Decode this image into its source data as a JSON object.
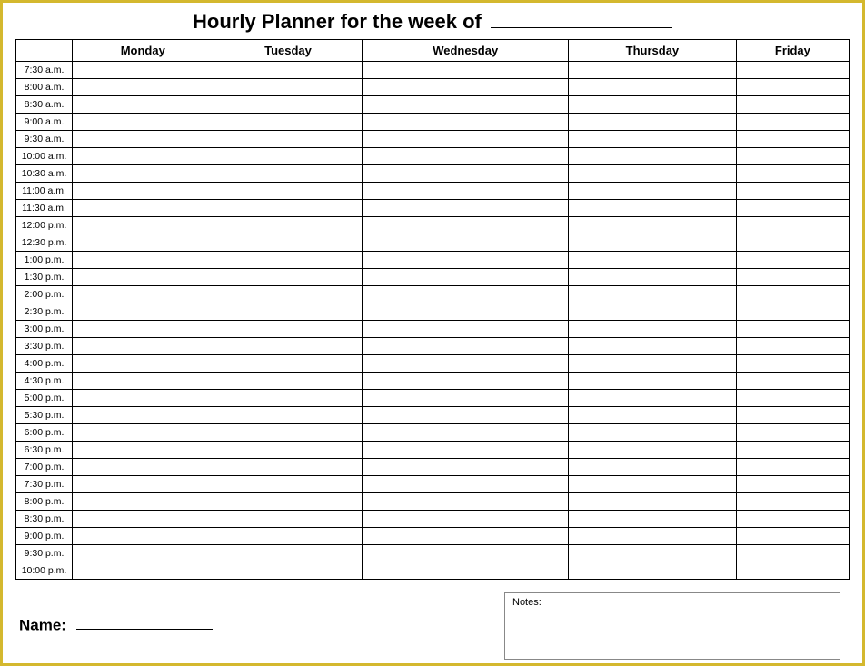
{
  "title_prefix": "Hourly Planner for the week of",
  "days": [
    "Monday",
    "Tuesday",
    "Wednesday",
    "Thursday",
    "Friday"
  ],
  "times": [
    "7:30 a.m.",
    "8:00 a.m.",
    "8:30 a.m.",
    "9:00 a.m.",
    "9:30 a.m.",
    "10:00 a.m.",
    "10:30 a.m.",
    "11:00 a.m.",
    "11:30 a.m.",
    "12:00 p.m.",
    "12:30 p.m.",
    "1:00 p.m.",
    "1:30 p.m.",
    "2:00 p.m.",
    "2:30 p.m.",
    "3:00 p.m.",
    "3:30 p.m.",
    "4:00 p.m.",
    "4:30 p.m.",
    "5:00 p.m.",
    "5:30 p.m.",
    "6:00 p.m.",
    "6:30 p.m.",
    "7:00 p.m.",
    "7:30 p.m.",
    "8:00 p.m.",
    "8:30 p.m.",
    "9:00 p.m.",
    "9:30 p.m.",
    "10:00 p.m."
  ],
  "name_label": "Name:",
  "notes_label": "Notes:"
}
